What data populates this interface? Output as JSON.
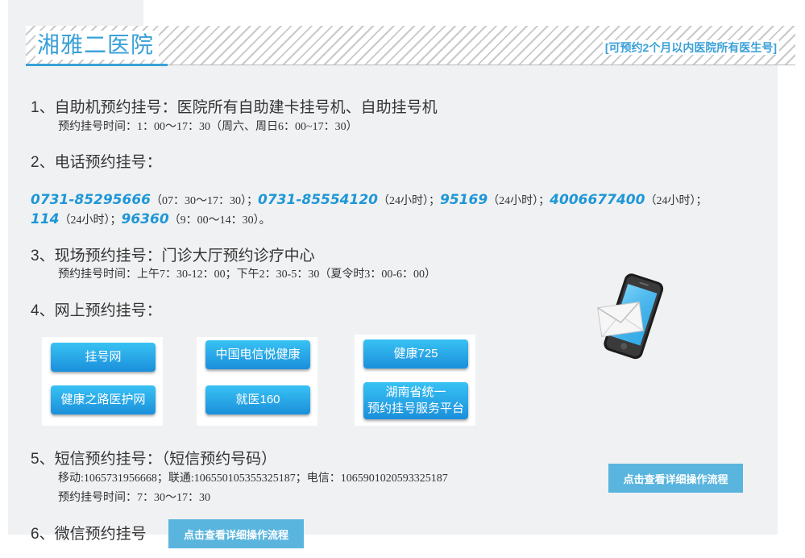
{
  "header": {
    "title": "湘雅二医院",
    "note": "[可预约2个月以内医院所有医生号]"
  },
  "sections": {
    "s1": {
      "title": "1、自助机预约挂号：医院所有自助建卡挂号机、自助挂号机",
      "time": "预约挂号时间：1：00～17：30（周六、周日6：00~17：30）"
    },
    "s2": {
      "title": "2、电话预约挂号：",
      "phones": [
        {
          "number": "0731-85295666",
          "hours": "（07：30～17：30）；"
        },
        {
          "number": "0731-85554120",
          "hours": "（24小时）；"
        },
        {
          "number": "95169",
          "hours": "（24小时）；"
        },
        {
          "number": "4006677400",
          "hours": "（24小时）；"
        },
        {
          "number": "114",
          "hours": "（24小时）；"
        },
        {
          "number": "96360",
          "hours": "（9：00～14：30）。"
        }
      ]
    },
    "s3": {
      "title": "3、现场预约挂号：门诊大厅预约诊疗中心",
      "time": "预约挂号时间：上午7：30-12：00；下午2：30-5：30（夏令时3：00-6：00）"
    },
    "s4": {
      "title": "4、网上预约挂号：",
      "buttons": {
        "guahaowang": "挂号网",
        "jiankang_zhilu": "健康之路医护网",
        "dianxin": "中国电信悦健康",
        "jiuyi160": "就医160",
        "jiankang725": "健康725",
        "hunan_line1": "湖南省统一",
        "hunan_line2": "预约挂号服务平台"
      }
    },
    "s5": {
      "title": "5、短信预约挂号：（短信预约号码）",
      "numbers": "移动:1065731956668；联通:106550105355325187；电信：1065901020593325187",
      "time": "预约挂号时间：7：30～17：30",
      "detail_button": "点击查看详细操作流程"
    },
    "s6": {
      "title": "6、微信预约挂号",
      "detail_button": "点击查看详细操作流程"
    }
  },
  "colors": {
    "accent": "#3aa0d8",
    "phone_number": "#1e97d6",
    "button_gradient_top": "#38c2f4",
    "button_gradient_bottom": "#1b8fdb",
    "detail_button": "#5ab5de",
    "panel_bg": "#f0f1f3"
  },
  "icons": {
    "phone_email": "smartphone-envelope-icon"
  }
}
